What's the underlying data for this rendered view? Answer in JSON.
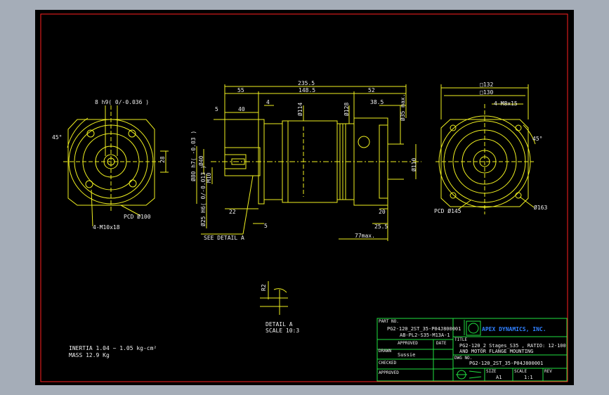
{
  "drawing": {
    "background": "#000000",
    "border_color": "#ff2020",
    "line_color": "#f0f020",
    "text_color": "#f0f0f0",
    "title_color": "#20e040",
    "dims": {
      "overall_length": "235.5",
      "len_55": "55",
      "len_1485": "148.5",
      "len_52": "52",
      "len_385": "38.5",
      "len_4": "4",
      "len_40": "40",
      "len_5": "5",
      "len_22": "22",
      "len_20": "20",
      "len_255": "25.5",
      "len_5b": "5",
      "max_len": "77max.",
      "dia_114": "Ø114",
      "dia_128": "Ø128",
      "dia_35max": "Ø35 max.",
      "dia_110": "Ø110",
      "dia_80": "Ø80 h7( -0.03 )",
      "dia_40": "Ø40",
      "dia_25": "Ø25 H6( 0/-0.013 )",
      "m10": "M10",
      "sq_132": "□132",
      "sq_130": "□130",
      "holes_right": "4-M8x15",
      "angle_right": "45°",
      "pcd_145": "PCD Ø145",
      "dia_163": "Ø163",
      "key_width": "8 h9( 0/-0.036 )",
      "dim_28": "28",
      "angle_left": "45°",
      "pcd_100": "PCD Ø100",
      "holes_left": "4-M10x18",
      "see_detail": "SEE DETAIL A",
      "detail_r": "R2",
      "detail_label": "DETAIL A",
      "detail_scale": "SCALE 10:3"
    },
    "inertia": "INERTIA 1.04 ~ 1.05 kg-cm²",
    "mass": "MASS 12.9 Kg"
  },
  "title_block": {
    "part_no_label": "PART NO.",
    "part_no_1": "PG2-120_2ST_35-P04J800001",
    "part_no_2": "AB-PL2-S35-M13A-1",
    "approved_label": "APPROVED",
    "date_label": "DATE",
    "drawn_label": "DRAWN",
    "drawn_value": "Sussie",
    "checked_label": "CHECKED",
    "approved2_label": "APPROVED",
    "company": "APEX DYNAMICS, INC.",
    "title_label": "TITLE",
    "title_1": "PG2-120_2 Stages_S35 , RATIO: 12-100",
    "title_2": "AND MOTOR FLANGE MOUNTING",
    "dwg_label": "DWG NO.",
    "dwg_value": "PG2-120_2ST_35-P04J800001",
    "size_label": "SIZE",
    "size_value": "A1",
    "scale_label": "SCALE",
    "scale_value": "1:1",
    "rev_label": "REV"
  }
}
